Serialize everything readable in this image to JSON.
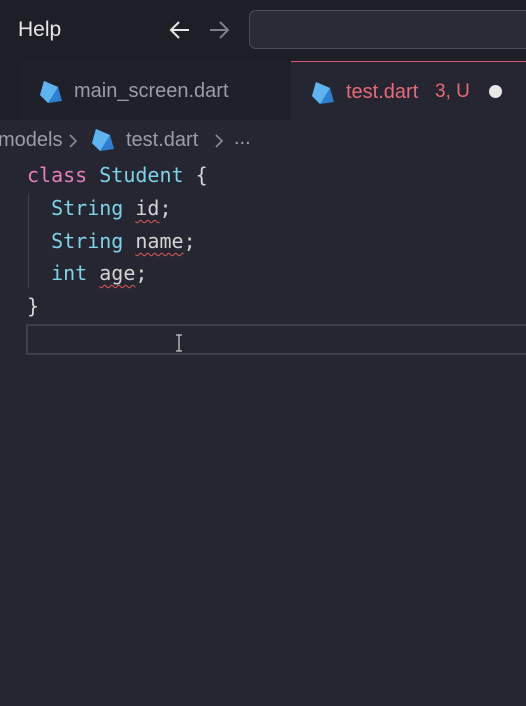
{
  "menu": {
    "help_label": "Help"
  },
  "navigation": {
    "back_icon": "arrow-left-icon",
    "forward_icon": "arrow-right-icon"
  },
  "search": {
    "value": ""
  },
  "tabs": [
    {
      "label": "main_screen.dart",
      "icon": "dart-file-icon",
      "active": false
    },
    {
      "label": "test.dart",
      "status": "3, U",
      "icon": "dart-file-icon",
      "active": true,
      "modified": true
    }
  ],
  "breadcrumb": {
    "folder": "models",
    "file": "test.dart",
    "ellipsis": "..."
  },
  "code": {
    "line1": {
      "keyword": "class",
      "class_name": "Student",
      "brace": "{"
    },
    "line2": {
      "type": "String",
      "name": "id",
      "semi": ";"
    },
    "line3": {
      "type": "String",
      "name": "name",
      "semi": ";"
    },
    "line4": {
      "type": "int",
      "name": "age",
      "semi": ";"
    },
    "line5": {
      "brace": "}"
    }
  },
  "colors": {
    "background": "#252631",
    "accent_tab": "#e8697a",
    "keyword": "#e87fb8",
    "type": "#7fd3e6",
    "error_squiggle": "#e05a5a"
  }
}
